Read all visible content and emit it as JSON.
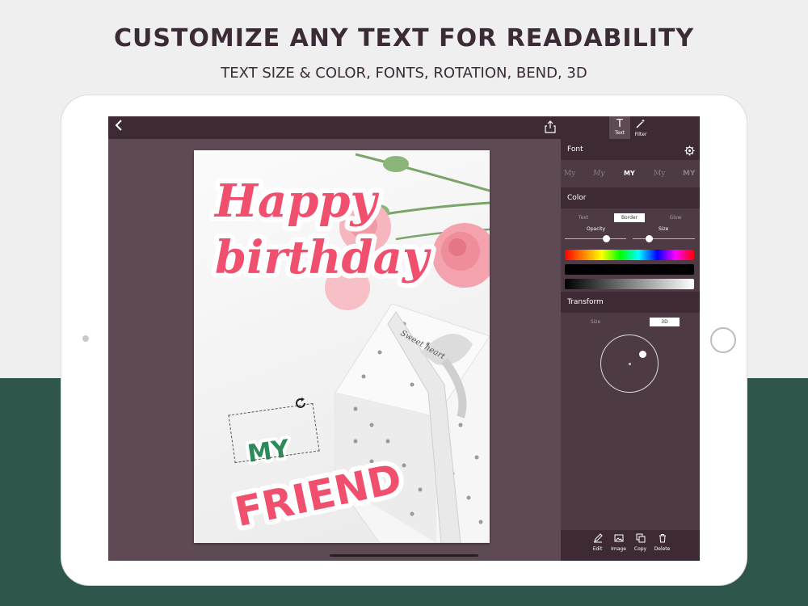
{
  "headline": "CUSTOMIZE ANY TEXT FOR READABILITY",
  "subheadline": "TEXT SIZE & COLOR, FONTS, ROTATION, BEND, 3D",
  "topbar": {
    "back_icon": "chevron-left-icon",
    "share_icon": "share-icon",
    "tabs": [
      {
        "label": "Text",
        "icon": "text-icon",
        "active": true
      },
      {
        "label": "Filter",
        "icon": "magic-wand-icon",
        "active": false
      }
    ]
  },
  "card": {
    "line1": "Happy",
    "line2": "birthday",
    "selected_text": "MY",
    "text3": "FRIEND",
    "ribbon_text": "Sweet heart",
    "rotate_icon": "rotate-icon",
    "colors": {
      "pink": "#f0506e",
      "green": "#2e8a5a"
    }
  },
  "panel": {
    "font": {
      "title": "Font",
      "settings_icon": "gear-icon",
      "samples": [
        "My",
        "My",
        "MY",
        "My",
        "MY"
      ],
      "active_index": 2
    },
    "color": {
      "title": "Color",
      "tabs": [
        "Text",
        "Border",
        "Glow"
      ],
      "active_tab": 1,
      "opacity_label": "Opacity",
      "size_label": "Size",
      "opacity_value": 0.5,
      "size_value": 0.3
    },
    "transform": {
      "title": "Transform",
      "tabs": [
        "Size",
        "3D"
      ],
      "active_tab": 1
    },
    "actions": [
      {
        "label": "Edit",
        "icon": "edit-icon"
      },
      {
        "label": "Image",
        "icon": "image-icon"
      },
      {
        "label": "Copy",
        "icon": "copy-icon"
      },
      {
        "label": "Delete",
        "icon": "trash-icon"
      }
    ]
  }
}
